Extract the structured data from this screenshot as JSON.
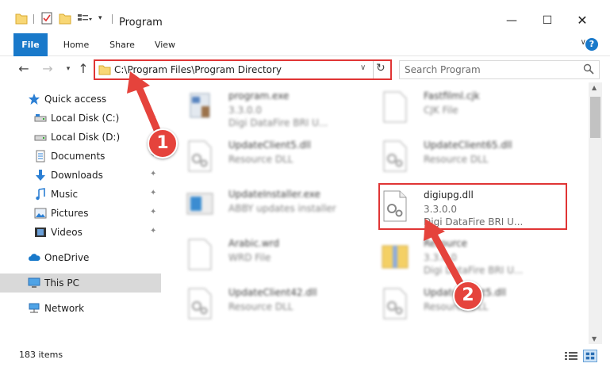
{
  "window": {
    "title": "Program",
    "minimize_glyph": "—",
    "maximize_glyph": "☐",
    "close_glyph": "✕"
  },
  "ribbon": {
    "tabs": [
      "File",
      "Home",
      "Share",
      "View"
    ],
    "expand_glyph": "∨",
    "help_glyph": "?"
  },
  "address": {
    "path": "C:\\Program Files\\Program Directory",
    "search_placeholder": "Search Program"
  },
  "sidebar": {
    "items": [
      {
        "label": "Quick access",
        "icon": "star-icon",
        "pinned": false
      },
      {
        "label": "Local Disk (C:)",
        "icon": "drive-icon",
        "pinned": true
      },
      {
        "label": "Local Disk (D:)",
        "icon": "drive-icon",
        "pinned": true
      },
      {
        "label": "Documents",
        "icon": "documents-icon",
        "pinned": true
      },
      {
        "label": "Downloads",
        "icon": "downloads-icon",
        "pinned": true
      },
      {
        "label": "Music",
        "icon": "music-icon",
        "pinned": true
      },
      {
        "label": "Pictures",
        "icon": "pictures-icon",
        "pinned": true
      },
      {
        "label": "Videos",
        "icon": "videos-icon",
        "pinned": true
      },
      {
        "label": "OneDrive",
        "icon": "cloud-icon",
        "pinned": false
      },
      {
        "label": "This PC",
        "icon": "computer-icon",
        "pinned": false,
        "selected": true
      },
      {
        "label": "Network",
        "icon": "network-icon",
        "pinned": false
      }
    ],
    "pin_glyph": "📌"
  },
  "files": [
    {
      "name": "program.exe",
      "line2": "3.3.0.0",
      "line3": "Digi DataFire BRI U...",
      "icon": "exe-icon",
      "blurred": true
    },
    {
      "name": "Fastfilml.cjk",
      "line2": "CJK File",
      "line3": "",
      "icon": "blank-file-icon",
      "blurred": true
    },
    {
      "name": "UpdateClient5.dll",
      "line2": "Resource DLL",
      "line3": "",
      "icon": "dll-icon",
      "blurred": true
    },
    {
      "name": "UpdateClient65.dll",
      "line2": "Resource DLL",
      "line3": "",
      "icon": "dll-icon",
      "blurred": true
    },
    {
      "name": "UpdateInstaller.exe",
      "line2": "ABBY updates installer",
      "line3": "",
      "icon": "installer-icon",
      "blurred": true
    },
    {
      "name": "digiupg.dll",
      "line2": "3.3.0.0",
      "line3": "Digi DataFire BRI U...",
      "icon": "dll-icon",
      "blurred": false
    },
    {
      "name": "Arabic.wrd",
      "line2": "WRD File",
      "line3": "",
      "icon": "blank-file-icon",
      "blurred": true
    },
    {
      "name": "Resource",
      "line2": "3.3.0.0",
      "line3": "Digi DataFire BRI U...",
      "icon": "archive-icon",
      "blurred": true
    },
    {
      "name": "UpdateClient42.dll",
      "line2": "Resource DLL",
      "line3": "",
      "icon": "dll-icon",
      "blurred": true
    },
    {
      "name": "UpdateClient5.dll",
      "line2": "Resource DLL",
      "line3": "",
      "icon": "dll-icon",
      "blurred": true
    }
  ],
  "status": {
    "item_count": "183 items"
  },
  "callouts": [
    "1",
    "2"
  ],
  "colors": {
    "accent": "#1979ca",
    "highlight": "#e03535",
    "selected_bg": "#d9d9d9"
  }
}
